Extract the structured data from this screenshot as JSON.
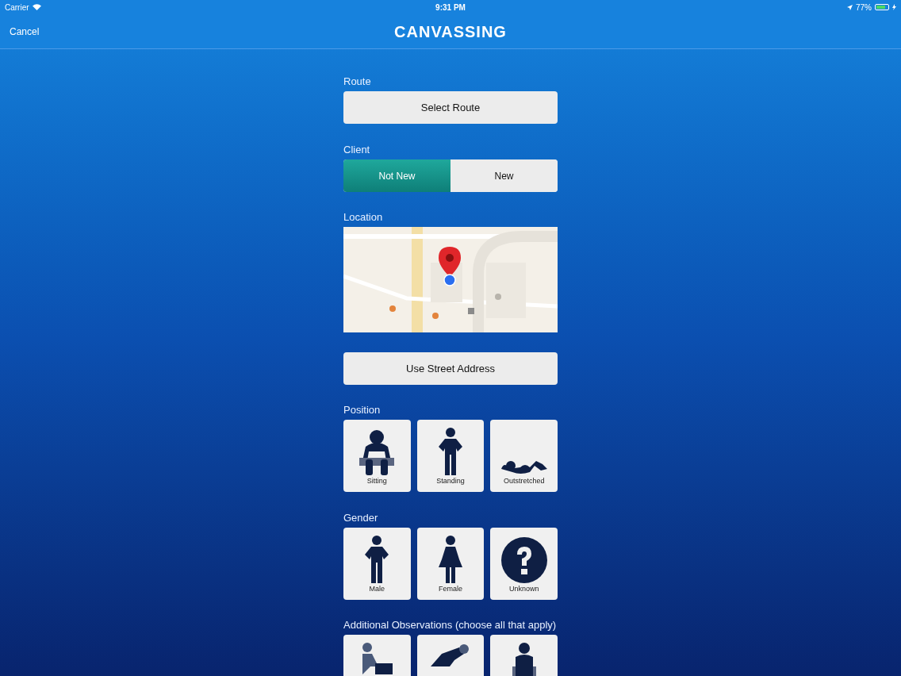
{
  "status_bar": {
    "carrier": "Carrier",
    "time": "9:31 PM",
    "battery": "77%"
  },
  "nav": {
    "cancel": "Cancel",
    "title": "CANVASSING"
  },
  "route": {
    "label": "Route",
    "button": "Select Route"
  },
  "client": {
    "label": "Client",
    "options": [
      {
        "label": "Not New",
        "selected": true
      },
      {
        "label": "New",
        "selected": false
      }
    ]
  },
  "location": {
    "label": "Location",
    "button": "Use Street Address"
  },
  "position": {
    "label": "Position",
    "options": [
      {
        "kind": "sitting",
        "label": "Sitting"
      },
      {
        "kind": "standing",
        "label": "Standing"
      },
      {
        "kind": "outstretched",
        "label": "Outstretched"
      }
    ]
  },
  "gender": {
    "label": "Gender",
    "options": [
      {
        "kind": "male",
        "label": "Male"
      },
      {
        "kind": "female",
        "label": "Female"
      },
      {
        "kind": "unknown",
        "label": "Unknown"
      }
    ]
  },
  "observations": {
    "label": "Additional Observations (choose all that apply)",
    "options": [
      {
        "kind": "walker"
      },
      {
        "kind": "lying"
      },
      {
        "kind": "wheelchair"
      }
    ]
  }
}
